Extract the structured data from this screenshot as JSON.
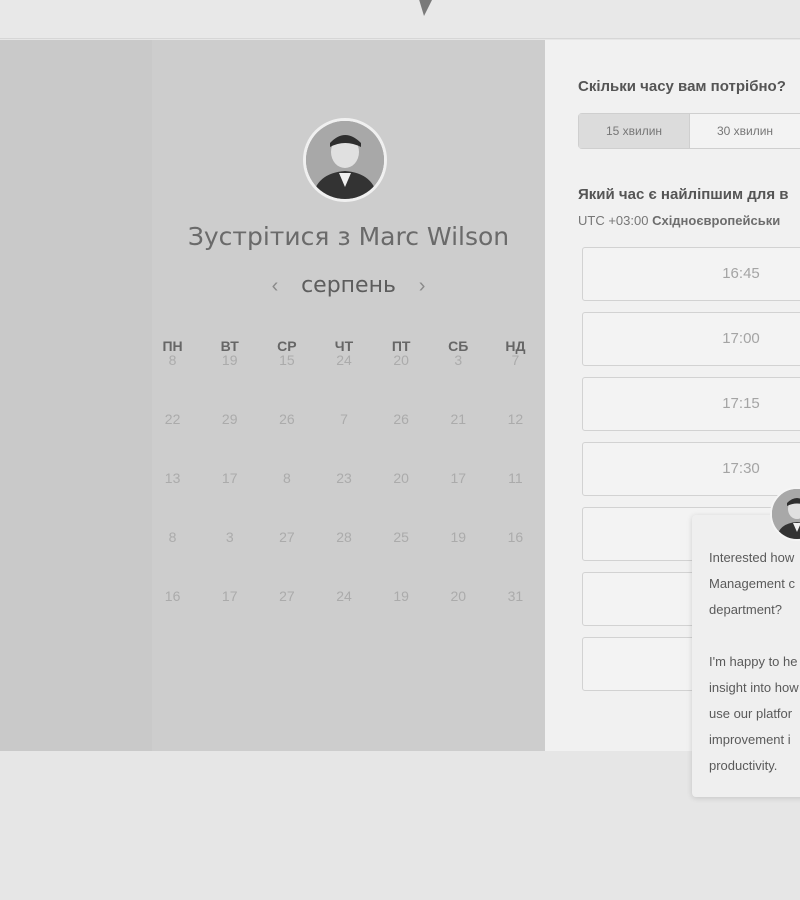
{
  "header": {
    "logo_icon": "speech-bubble-logo"
  },
  "scheduler": {
    "title": "Зустрітися з Marc Wilson",
    "month": "серпень",
    "prev_icon": "chevron-left-icon",
    "next_icon": "chevron-right-icon",
    "weekdays": [
      "ПН",
      "ВТ",
      "СР",
      "ЧТ",
      "ПТ",
      "СБ",
      "НД"
    ],
    "weeks": [
      [
        "8",
        "19",
        "15",
        "24",
        "20",
        "3",
        "7"
      ],
      [
        "22",
        "29",
        "26",
        "7",
        "26",
        "21",
        "12"
      ],
      [
        "13",
        "17",
        "8",
        "23",
        "20",
        "17",
        "11"
      ],
      [
        "8",
        "3",
        "27",
        "28",
        "25",
        "19",
        "16"
      ],
      [
        "16",
        "17",
        "27",
        "24",
        "19",
        "20",
        "31"
      ]
    ]
  },
  "booking": {
    "duration_question": "Скільки часу вам потрібно?",
    "durations": [
      "15 хвилин",
      "30 хвилин"
    ],
    "time_question": "Який час є найліпшим для в",
    "timezone_offset": "UTC +03:00",
    "timezone_name": "Східноєвропейськи",
    "slots": [
      "16:45",
      "17:00",
      "17:15",
      "17:30",
      "",
      "",
      "",
      ""
    ]
  },
  "chat": {
    "lines1": [
      "Interested how",
      "Management c",
      "department?"
    ],
    "lines2": [
      "I'm happy to he",
      "insight into how",
      "use our platfor",
      "improvement i",
      "productivity."
    ]
  }
}
